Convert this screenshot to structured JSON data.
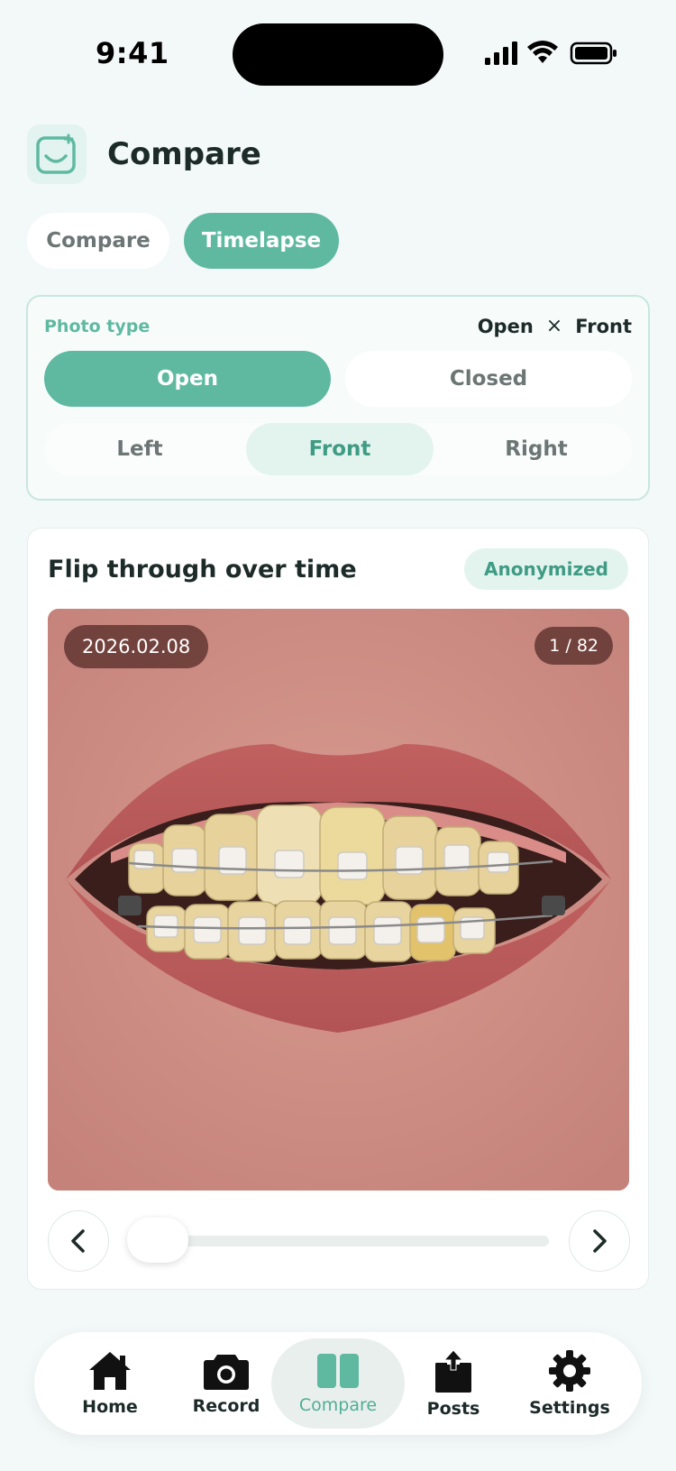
{
  "status_bar": {
    "time": "9:41"
  },
  "header": {
    "title": "Compare"
  },
  "mode_tabs": [
    {
      "label": "Compare",
      "active": false
    },
    {
      "label": "Timelapse",
      "active": true
    }
  ],
  "photo_type": {
    "label": "Photo type",
    "summary_left": "Open",
    "summary_sep": "×",
    "summary_right": "Front",
    "states": [
      {
        "label": "Open",
        "active": true
      },
      {
        "label": "Closed",
        "active": false
      }
    ],
    "views": [
      {
        "label": "Left",
        "active": false
      },
      {
        "label": "Front",
        "active": true
      },
      {
        "label": "Right",
        "active": false
      }
    ]
  },
  "flip": {
    "title": "Flip through over time",
    "badge": "Anonymized",
    "date": "2026.02.08",
    "counter": "1 / 82",
    "slider_position": 0.0
  },
  "bottom_nav": [
    {
      "label": "Home",
      "icon": "home-icon",
      "active": false
    },
    {
      "label": "Record",
      "icon": "camera-icon",
      "active": false
    },
    {
      "label": "Compare",
      "icon": "compare-icon",
      "active": true
    },
    {
      "label": "Posts",
      "icon": "share-icon",
      "active": false
    },
    {
      "label": "Settings",
      "icon": "gear-icon",
      "active": false
    }
  ],
  "colors": {
    "accent": "#5fb9a1",
    "accent_light": "#e3f4ef",
    "text": "#1c2a28",
    "muted": "#6c7674"
  }
}
